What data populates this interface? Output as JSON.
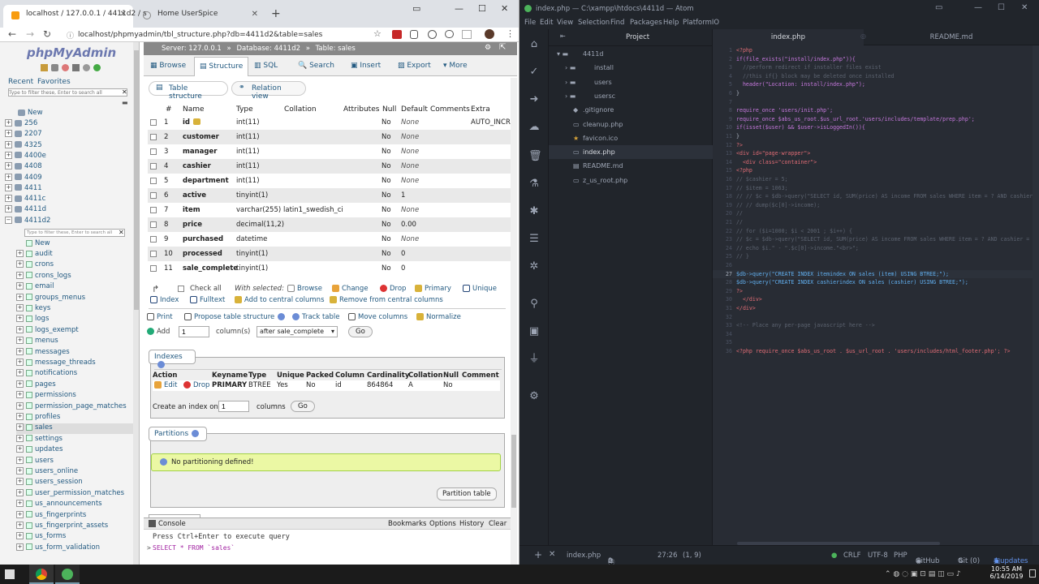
{
  "browser": {
    "tabs": [
      {
        "title": "localhost / 127.0.0.1 / 4411d2 / s"
      },
      {
        "title": "Home UserSpice"
      }
    ],
    "url": "localhost/phpmyadmin/tbl_structure.php?db=4411d2&table=sales"
  },
  "pma_nav": {
    "logo": "phpMyAdmin",
    "recent": "Recent",
    "favorites": "Favorites",
    "filter_placeholder": "Type to filter these, Enter to search all",
    "new": "New",
    "databases": [
      "256",
      "2207",
      "4325",
      "4400e",
      "4408",
      "4409",
      "4411",
      "4411c",
      "4411d",
      "4411d2"
    ],
    "db_filter_placeholder": "Type to filter these, Enter to search all",
    "sub_new": "New",
    "tables": [
      "audit",
      "crons",
      "crons_logs",
      "email",
      "groups_menus",
      "keys",
      "logs",
      "logs_exempt",
      "menus",
      "messages",
      "message_threads",
      "notifications",
      "pages",
      "permissions",
      "permission_page_matches",
      "profiles",
      "sales",
      "settings",
      "updates",
      "users",
      "users_online",
      "users_session",
      "user_permission_matches",
      "us_announcements",
      "us_fingerprints",
      "us_fingerprint_assets",
      "us_forms",
      "us_form_validation"
    ]
  },
  "pma_main": {
    "breadcrumb": {
      "server": "Server: 127.0.0.1",
      "database": "Database: 4411d2",
      "table": "Table: sales"
    },
    "menu": [
      "Browse",
      "Structure",
      "SQL",
      "Search",
      "Insert",
      "Export",
      "More"
    ],
    "subtabs": [
      "Table structure",
      "Relation view"
    ],
    "headers": [
      "#",
      "Name",
      "Type",
      "Collation",
      "Attributes",
      "Null",
      "Default",
      "Comments",
      "Extra"
    ],
    "columns": [
      {
        "num": "1",
        "name": "id",
        "type": "int(11)",
        "collation": "",
        "null": "No",
        "default": "None",
        "extra": "AUTO_INCR"
      },
      {
        "num": "2",
        "name": "customer",
        "type": "int(11)",
        "collation": "",
        "null": "No",
        "default": "None",
        "extra": ""
      },
      {
        "num": "3",
        "name": "manager",
        "type": "int(11)",
        "collation": "",
        "null": "No",
        "default": "None",
        "extra": ""
      },
      {
        "num": "4",
        "name": "cashier",
        "type": "int(11)",
        "collation": "",
        "null": "No",
        "default": "None",
        "extra": ""
      },
      {
        "num": "5",
        "name": "department",
        "type": "int(11)",
        "collation": "",
        "null": "No",
        "default": "None",
        "extra": ""
      },
      {
        "num": "6",
        "name": "active",
        "type": "tinyint(1)",
        "collation": "",
        "null": "No",
        "default": "1",
        "extra": ""
      },
      {
        "num": "7",
        "name": "item",
        "type": "varchar(255)",
        "collation": "latin1_swedish_ci",
        "null": "No",
        "default": "None",
        "extra": ""
      },
      {
        "num": "8",
        "name": "price",
        "type": "decimal(11,2)",
        "collation": "",
        "null": "No",
        "default": "0.00",
        "extra": ""
      },
      {
        "num": "9",
        "name": "purchased",
        "type": "datetime",
        "collation": "",
        "null": "No",
        "default": "None",
        "extra": ""
      },
      {
        "num": "10",
        "name": "processed",
        "type": "tinyint(1)",
        "collation": "",
        "null": "No",
        "default": "0",
        "extra": ""
      },
      {
        "num": "11",
        "name": "sale_complete",
        "type": "tinyint(1)",
        "collation": "",
        "null": "No",
        "default": "0",
        "extra": ""
      }
    ],
    "bulk": {
      "check_all": "Check all",
      "with_selected": "With selected:",
      "browse": "Browse",
      "change": "Change",
      "drop": "Drop",
      "primary": "Primary",
      "unique": "Unique",
      "index": "Index",
      "fulltext": "Fulltext",
      "add_central": "Add to central columns",
      "remove_central": "Remove from central columns"
    },
    "tools": {
      "print": "Print",
      "propose": "Propose table structure",
      "track": "Track table",
      "move": "Move columns",
      "normalize": "Normalize"
    },
    "add": {
      "label": "Add",
      "value": "1",
      "columns_label": "column(s)",
      "position": "after sale_complete",
      "go": "Go"
    },
    "indexes": {
      "legend": "Indexes",
      "headers": [
        "Action",
        "Keyname",
        "Type",
        "Unique",
        "Packed",
        "Column",
        "Cardinality",
        "Collation",
        "Null",
        "Comment"
      ],
      "row": {
        "edit": "Edit",
        "drop": "Drop",
        "keyname": "PRIMARY",
        "type": "BTREE",
        "unique": "Yes",
        "packed": "No",
        "column": "id",
        "cardinality": "864864",
        "collation": "A",
        "null": "No",
        "comment": ""
      },
      "create_label": "Create an index on",
      "create_value": "1",
      "columns_label": "columns",
      "go": "Go"
    },
    "partitions": {
      "legend": "Partitions",
      "message": "No partitioning defined!",
      "button": "Partition table"
    },
    "console": {
      "title": "Console",
      "bookmarks": "Bookmarks",
      "options": "Options",
      "history": "History",
      "clear": "Clear",
      "hint": "Press Ctrl+Enter to execute query",
      "query": "SELECT * FROM `sales`"
    }
  },
  "atom": {
    "title": "index.php — C:\\xampp\\htdocs\\4411d — Atom",
    "menu": [
      "File",
      "Edit",
      "View",
      "Selection",
      "Find",
      "Packages",
      "Help",
      "PlatformIO"
    ],
    "tree_header": "Project",
    "tree": [
      {
        "label": "4411d",
        "kind": "root"
      },
      {
        "label": "install",
        "kind": "dir"
      },
      {
        "label": "users",
        "kind": "dir"
      },
      {
        "label": "usersc",
        "kind": "dir"
      },
      {
        "label": ".gitignore",
        "kind": "file"
      },
      {
        "label": "cleanup.php",
        "kind": "file"
      },
      {
        "label": "favicon.ico",
        "kind": "file"
      },
      {
        "label": "index.php",
        "kind": "file"
      },
      {
        "label": "README.md",
        "kind": "file"
      },
      {
        "label": "z_us_root.php",
        "kind": "file"
      }
    ],
    "tabs": [
      "index.php",
      "README.md"
    ],
    "code": [
      "<?php",
      "if(file_exists(\"install/index.php\")){",
      "  //perform redirect if installer files exist",
      "  //this if{} block may be deleted once installed",
      "  header(\"Location: install/index.php\");",
      "}",
      "",
      "require_once 'users/init.php';",
      "require_once $abs_us_root.$us_url_root.'users/includes/template/prep.php';",
      "if(isset($user) && $user->isLoggedIn()){",
      "}",
      "?>",
      "<div id=\"page-wrapper\">",
      "  <div class=\"container\">",
      "<?php",
      "// $cashier = 5;",
      "// $item = 1063;",
      "// // $c = $db->query(\"SELECT id, SUM(price) AS income FROM sales WHERE item = ? AND cashier",
      "// // dump($c[0]->income);",
      "//",
      "//",
      "// for ($i=1000; $i < 2001 ; $i++) {",
      "// $c = $db->query(\"SELECT id, SUM(price) AS income FROM sales WHERE item = ? AND cashier =",
      "// echo $i.\" - \".$c[0]->income.\"<br>\";",
      "// }",
      "",
      "$db->query(\"CREATE INDEX itemindex ON sales (item) USING BTREE;\");",
      "$db->query(\"CREATE INDEX cashierindex ON sales (cashier) USING BTREE;\");",
      "?>",
      "  </div>",
      "</div>",
      "",
      "<!-- Place any per-page javascript here -->",
      "",
      "",
      "<?php require_once $abs_us_root . $us_url_root . 'users/includes/html_footer.php'; ?>"
    ],
    "status": {
      "file": "index.php",
      "errors": "0",
      "warnings": "0",
      "infos": "0",
      "cursor": "27:26",
      "selection": "(1, 9)",
      "eol": "CRLF",
      "encoding": "UTF-8",
      "grammar": "PHP",
      "github": "GitHub",
      "git": "Git (0)",
      "updates": "4 updates"
    }
  },
  "taskbar": {
    "time": "10:55 AM",
    "date": "6/14/2019"
  }
}
